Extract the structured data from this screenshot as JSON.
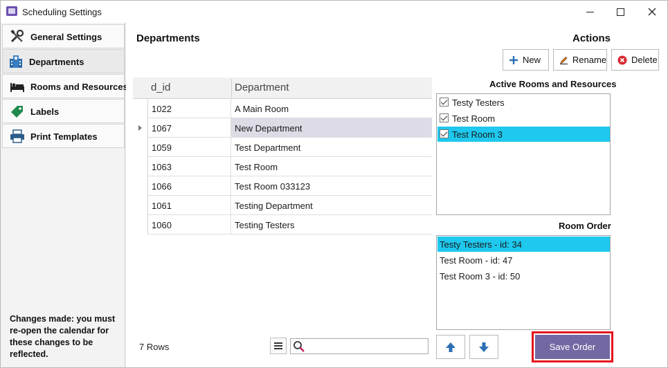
{
  "window": {
    "title": "Scheduling Settings",
    "accent_color": "#1ec8ee",
    "save_button_color": "#7468a3",
    "highlight_border_color": "#e3121c"
  },
  "sidebar": {
    "items": [
      {
        "label": "General Settings",
        "icon": "tools-icon"
      },
      {
        "label": "Departments",
        "icon": "building-icon"
      },
      {
        "label": "Rooms and Resources",
        "icon": "bed-icon"
      },
      {
        "label": "Labels",
        "icon": "tag-icon"
      },
      {
        "label": "Print Templates",
        "icon": "printer-icon"
      }
    ],
    "note": "Changes made: you must re-open the calendar for these changes to be reflected."
  },
  "departments": {
    "title": "Departments",
    "columns": [
      "d_id",
      "Department"
    ],
    "rows": [
      {
        "id": "1022",
        "name": "A Main Room"
      },
      {
        "id": "1067",
        "name": "New Department"
      },
      {
        "id": "1059",
        "name": "Test Department"
      },
      {
        "id": "1063",
        "name": "Test Room"
      },
      {
        "id": "1066",
        "name": "Test Room 033123"
      },
      {
        "id": "1061",
        "name": "Testing Department"
      },
      {
        "id": "1060",
        "name": "Testing Testers"
      }
    ],
    "row_count": "7 Rows",
    "search_value": ""
  },
  "actions": {
    "title": "Actions",
    "new_label": "New",
    "rename_label": "Rename",
    "delete_label": "Delete"
  },
  "active_rooms": {
    "label": "Active Rooms and Resources",
    "items": [
      {
        "label": "Testy Testers",
        "checked": true
      },
      {
        "label": "Test Room",
        "checked": true
      },
      {
        "label": "Test Room 3",
        "checked": true
      }
    ]
  },
  "room_order": {
    "label": "Room Order",
    "items": [
      "Testy Testers - id: 34",
      "Test Room - id: 47",
      "Test Room 3 - id: 50"
    ]
  },
  "save_order_label": "Save Order"
}
